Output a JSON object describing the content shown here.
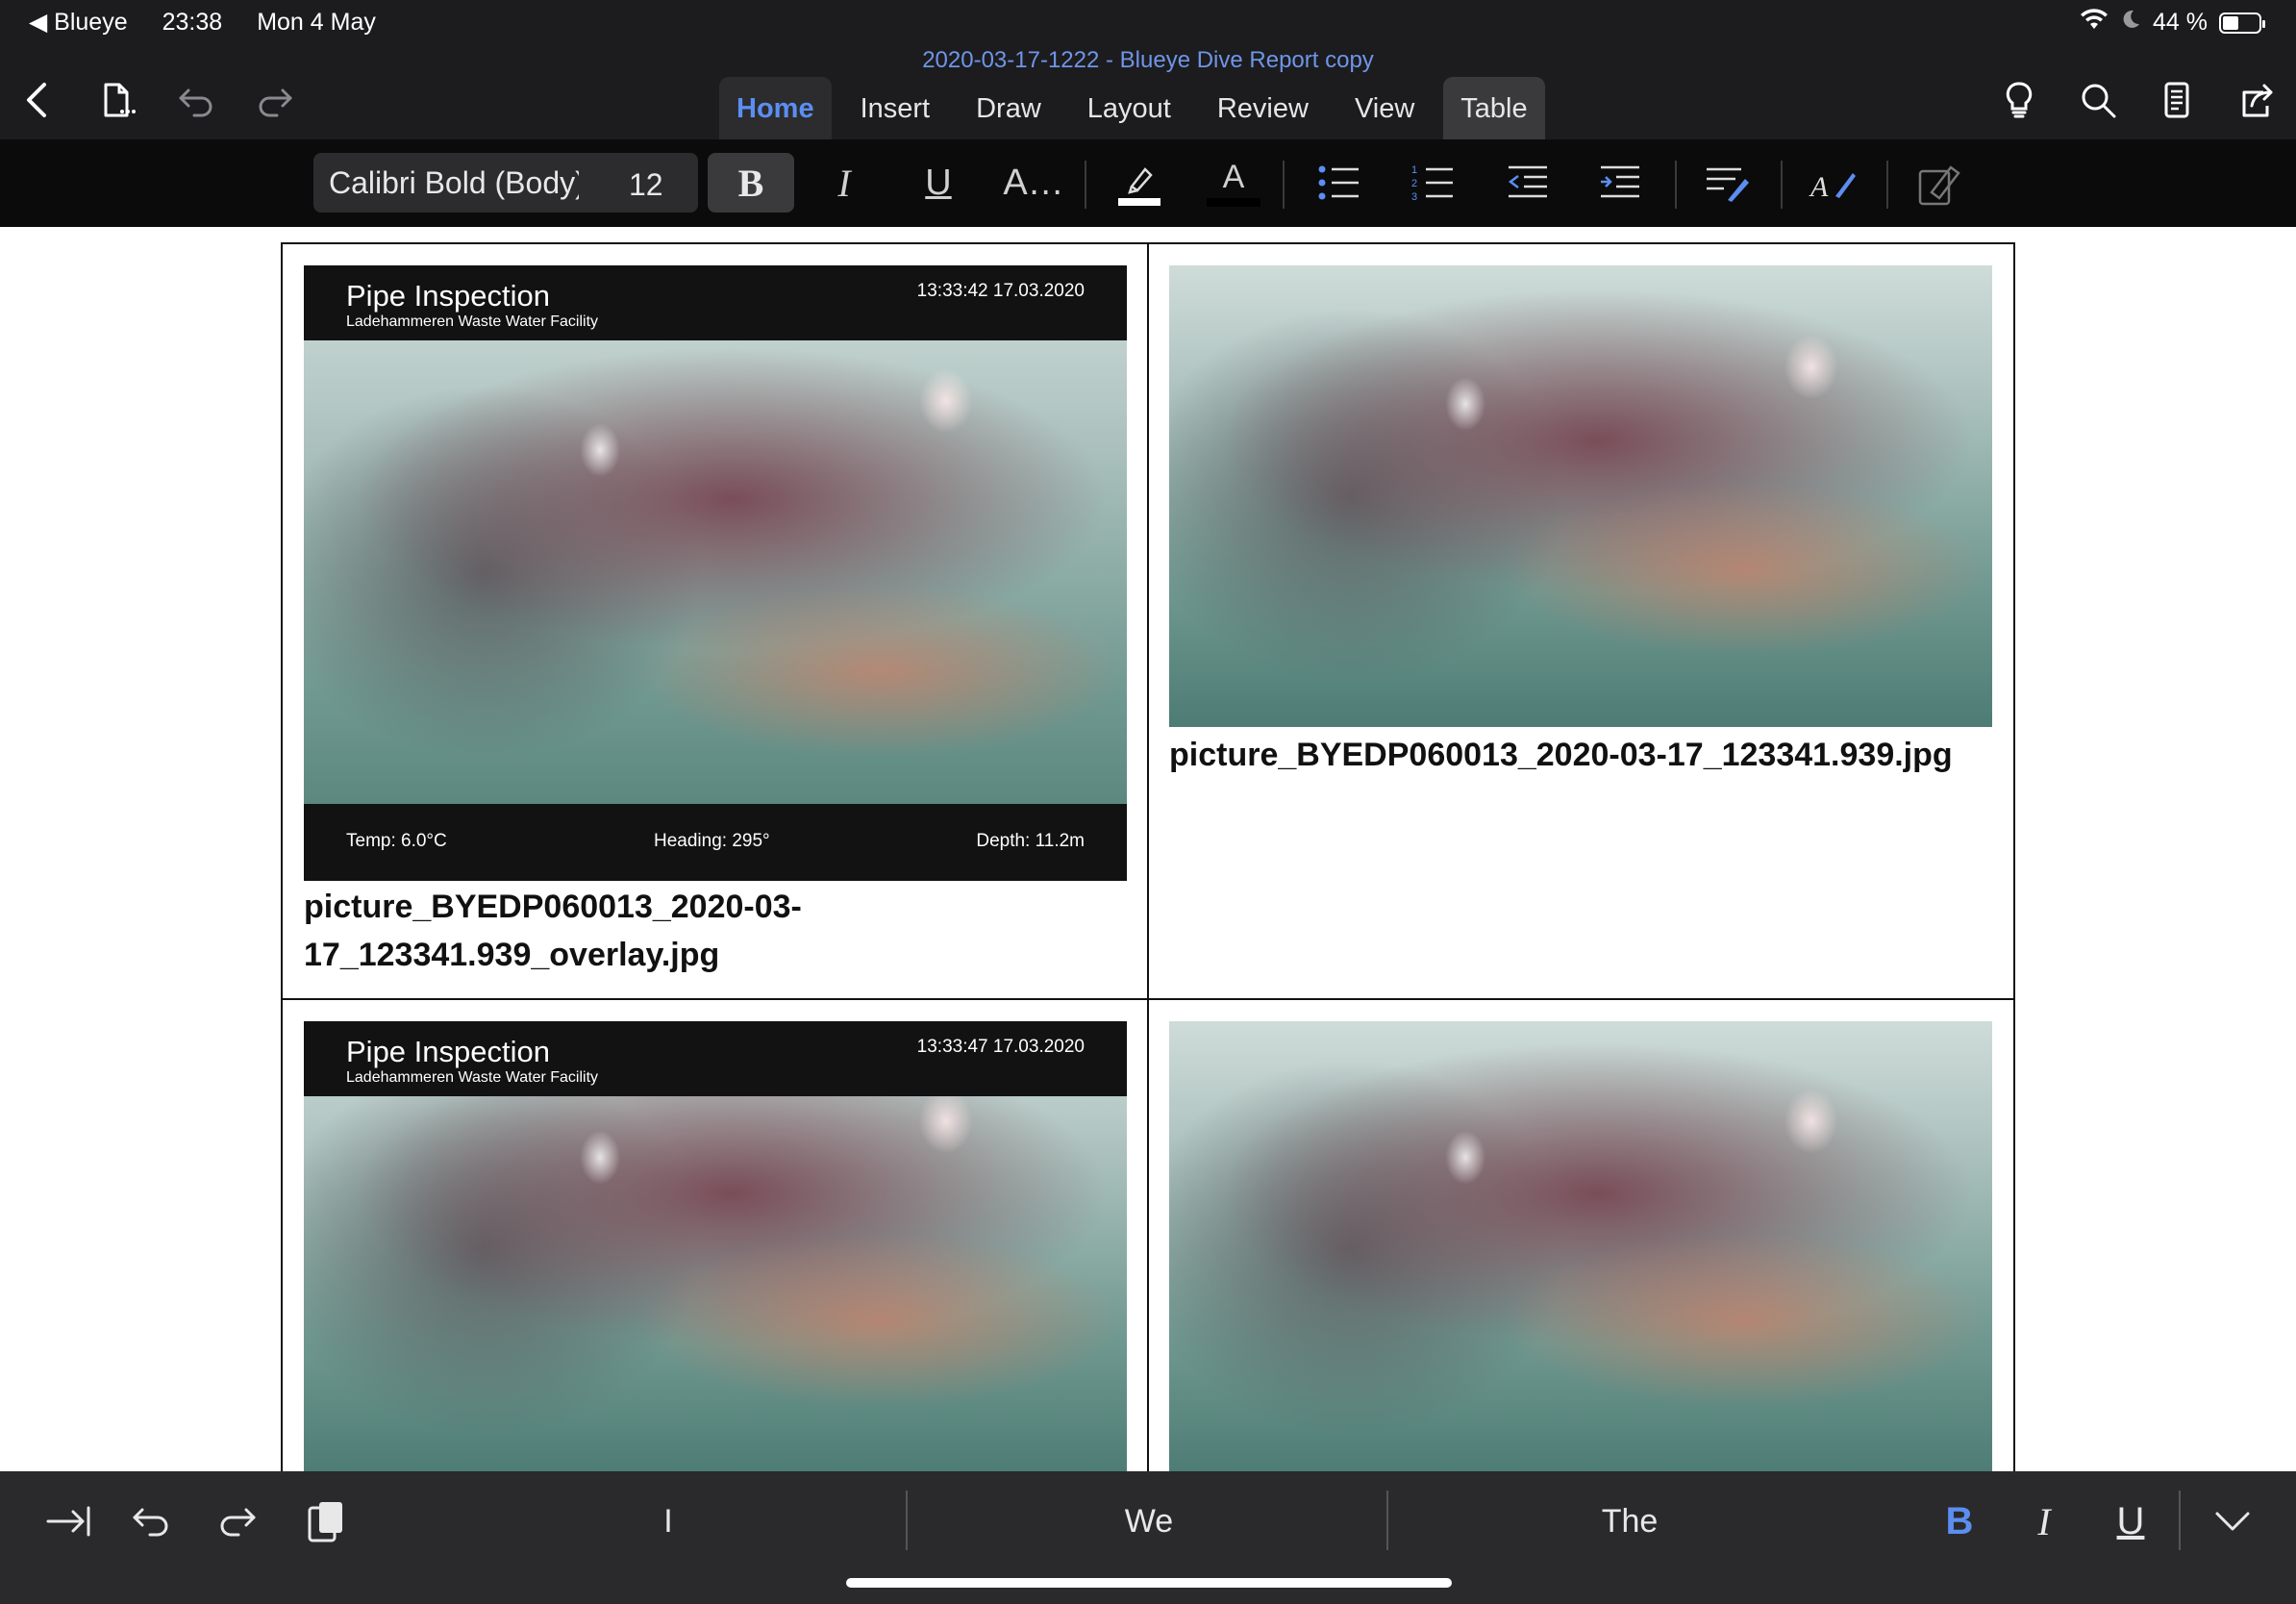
{
  "status_bar": {
    "back_app": "◀ Blueye",
    "time": "23:38",
    "date": "Mon 4 May",
    "battery": "44 %",
    "battery_level": 0.44
  },
  "title_bar": {
    "document_title": "2020-03-17-1222 - Blueye Dive Report copy",
    "tabs": [
      "Home",
      "Insert",
      "Draw",
      "Layout",
      "Review",
      "View",
      "Table"
    ],
    "active_tab": "Home",
    "icons": [
      "back-chevron-icon",
      "file-menu-icon",
      "undo-icon",
      "redo-icon",
      "lightbulb-icon",
      "search-icon",
      "reading-mode-icon",
      "share-icon"
    ]
  },
  "ribbon": {
    "font_name": "Calibri Bold (Body)",
    "font_size": "12",
    "bold_label": "B",
    "italic_label": "I",
    "underline_label": "U",
    "more_text_label": "A…",
    "font_color_label": "A",
    "highlight_color": "#ffffff",
    "font_color": "#000000"
  },
  "document": {
    "cells": [
      {
        "overlay": {
          "title": "Pipe Inspection",
          "subtitle": "Ladehammeren Waste Water Facility",
          "timestamp": "13:33:42 17.03.2020",
          "temp": "Temp: 6.0°C",
          "heading": "Heading: 295°",
          "depth": "Depth: 11.2m"
        },
        "caption_line1": "picture_BYEDP060013_2020-03-",
        "caption_line2": "17_123341.939_overlay.jpg"
      },
      {
        "caption": "picture_BYEDP060013_2020-03-17_123341.939.jpg"
      },
      {
        "overlay": {
          "title": "Pipe Inspection",
          "subtitle": "Ladehammeren Waste Water Facility",
          "timestamp": "13:33:47 17.03.2020"
        }
      },
      {}
    ]
  },
  "keyboard_bar": {
    "suggestions": [
      "I",
      "We",
      "The"
    ],
    "bold_label": "B",
    "italic_label": "I",
    "underline_label": "U"
  },
  "colors": {
    "accent": "#5c8ef2",
    "chrome_dark": "#1c1c1e",
    "ribbon": "#0b0b0c",
    "keyboard_bar": "#2a2a2c"
  }
}
